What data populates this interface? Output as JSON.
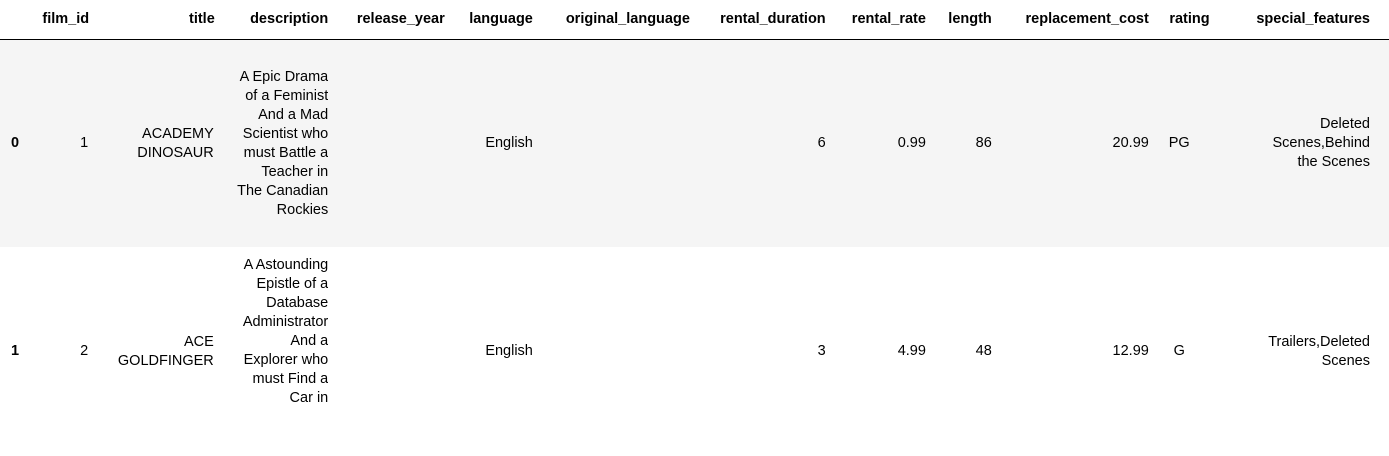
{
  "columns": [
    "",
    "film_id",
    "title",
    "description",
    "release_year",
    "language",
    "original_language",
    "rental_duration",
    "rental_rate",
    "length",
    "replacement_cost",
    "rating",
    "special_features"
  ],
  "rows": [
    {
      "index": "0",
      "film_id": "1",
      "title": "ACADEMY DINOSAUR",
      "description": "A Epic Drama of a Feminist And a Mad Scientist who must Battle a Teacher in The Canadian Rockies",
      "release_year": "",
      "language": "English",
      "original_language": "",
      "rental_duration": "6",
      "rental_rate": "0.99",
      "length": "86",
      "replacement_cost": "20.99",
      "rating": "PG",
      "special_features": "Deleted Scenes,Behind the Scenes"
    },
    {
      "index": "1",
      "film_id": "2",
      "title": "ACE GOLDFINGER",
      "description": "A Astounding Epistle of a Database Administrator And a Explorer who must Find a Car in",
      "release_year": "",
      "language": "English",
      "original_language": "",
      "rental_duration": "3",
      "rental_rate": "4.99",
      "length": "48",
      "replacement_cost": "12.99",
      "rating": "G",
      "special_features": "Trailers,Deleted Scenes"
    }
  ]
}
